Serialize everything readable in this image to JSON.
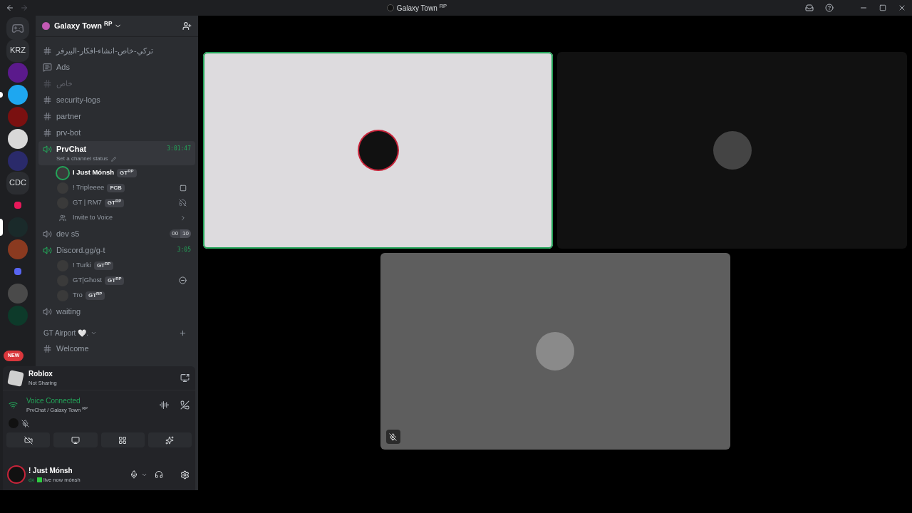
{
  "window": {
    "title": "Galaxy Town $^{RP}$"
  },
  "servers": [
    {
      "kind": "home",
      "selected": false,
      "unread": false
    },
    {
      "kind": "text",
      "label": "KRZ",
      "selected": false,
      "unread": false
    },
    {
      "kind": "image",
      "color": "#5b1a8c",
      "selected": false,
      "unread": false
    },
    {
      "kind": "image",
      "color": "#1ea7f0",
      "selected": false,
      "unread": true
    },
    {
      "kind": "image",
      "color": "#7a1010",
      "selected": false,
      "unread": false
    },
    {
      "kind": "image",
      "color": "#d8d8d8",
      "selected": false,
      "unread": false
    },
    {
      "kind": "image",
      "color": "#2a2a6a",
      "selected": false,
      "unread": false
    },
    {
      "kind": "text",
      "label": "CDC",
      "selected": false,
      "unread": false
    },
    {
      "kind": "folder",
      "color": "#e8185a",
      "selected": false,
      "unread": false
    },
    {
      "kind": "image",
      "color": "#1a2a2a",
      "selected": true,
      "unread": false
    },
    {
      "kind": "image",
      "color": "#8a3a20",
      "selected": false,
      "unread": false
    },
    {
      "kind": "folder",
      "color": "#5865f2",
      "selected": false,
      "unread": false
    },
    {
      "kind": "image",
      "color": "#4a4a4a",
      "selected": false,
      "unread": false
    },
    {
      "kind": "image",
      "color": "#0d3a2a",
      "selected": false,
      "unread": false
    }
  ],
  "new_badge": "NEW",
  "server": {
    "name": "Galaxy Town $^{RP}$"
  },
  "channels": [
    {
      "kind": "text",
      "name": "تركي-خاص-انشاء-افكار-البيرفر",
      "muted": false
    },
    {
      "kind": "forum",
      "name": "Ads",
      "muted": false
    },
    {
      "kind": "text",
      "name": "خاص",
      "muted": true
    },
    {
      "kind": "text",
      "name": "security-logs",
      "muted": false
    },
    {
      "kind": "text",
      "name": "partner",
      "muted": false
    },
    {
      "kind": "text",
      "name": "prv-bot",
      "muted": false
    },
    {
      "kind": "voice",
      "name": "PrvChat",
      "active": true,
      "selected": true,
      "time": "3:01:47",
      "status": "Set a channel status",
      "users": [
        {
          "name": "I Just Mónsh",
          "tag": "GT$^{RP}$",
          "speaking": true,
          "kind": "plain"
        },
        {
          "name": "! Tripleeee",
          "tag": "FCB",
          "speaking": false,
          "kind": "game"
        },
        {
          "name": "GT | RM7",
          "tag": "GT$^{RP}$",
          "speaking": false,
          "kind": "deafened"
        }
      ],
      "invite": "Invite to Voice"
    },
    {
      "kind": "voice",
      "name": "dev s5",
      "active": false,
      "selected": false,
      "counts": [
        "00",
        "10"
      ]
    },
    {
      "kind": "voice",
      "name": "Discord.gg/g-t",
      "active": true,
      "selected": false,
      "time": "3:05",
      "users": [
        {
          "name": "! Turki",
          "tag": "GT$^{RP}$",
          "speaking": false,
          "kind": "plain"
        },
        {
          "name": "GT|Ghost",
          "tag": "GT$^{RP}$",
          "speaking": false,
          "kind": "idle"
        },
        {
          "name": "Tro",
          "tag": "GT$^{RP}$",
          "speaking": false,
          "kind": "plain"
        }
      ]
    },
    {
      "kind": "voice",
      "name": "waiting",
      "active": false,
      "selected": false
    },
    {
      "kind": "category",
      "name": "GT Airport 🤍."
    },
    {
      "kind": "text",
      "name": "Welcome",
      "muted": false
    }
  ],
  "activity": {
    "title": "Roblox",
    "subtitle": "Not Sharing"
  },
  "voice": {
    "status": "Voice Connected",
    "location": "PrvChat / Galaxy Town $^{RP}$"
  },
  "user": {
    "name": "! Just Mónsh",
    "status": "live now mónsh"
  },
  "tiles": [
    {
      "color": "#dddbde",
      "speaking": true,
      "muted": false
    },
    {
      "color": "#111111",
      "speaking": false,
      "muted": false
    },
    {
      "color": "#5e5e5e",
      "speaking": false,
      "muted": true
    }
  ]
}
